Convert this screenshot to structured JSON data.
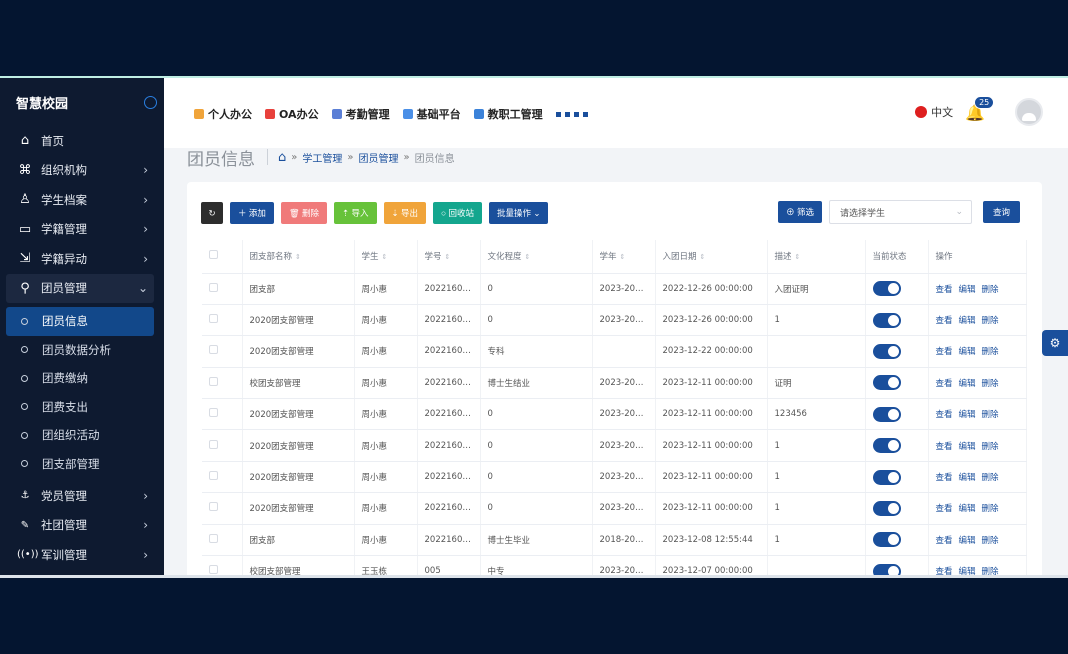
{
  "sidebar": {
    "title": "智慧校园",
    "items": [
      {
        "label": "首页",
        "icon": "⌂",
        "arrow": ""
      },
      {
        "label": "组织机构",
        "icon": "⌘",
        "arrow": "›"
      },
      {
        "label": "学生档案",
        "icon": "♙",
        "arrow": "›"
      },
      {
        "label": "学籍管理",
        "icon": "▭",
        "arrow": "›"
      },
      {
        "label": "学籍异动",
        "icon": "⇲",
        "arrow": "›"
      },
      {
        "label": "团员管理",
        "icon": "⚲",
        "arrow": "⌄"
      }
    ],
    "sub_items": [
      {
        "label": "团员信息"
      },
      {
        "label": "团员数据分析"
      },
      {
        "label": "团费缴纳"
      },
      {
        "label": "团费支出"
      },
      {
        "label": "团组织活动"
      },
      {
        "label": "团支部管理"
      }
    ],
    "bottom_items": [
      {
        "label": "党员管理",
        "icon": "⚓",
        "arrow": "›"
      },
      {
        "label": "社团管理",
        "icon": "✎",
        "arrow": "›"
      },
      {
        "label": "军训管理",
        "icon": "((•))",
        "arrow": "›"
      }
    ]
  },
  "header": {
    "nav": [
      {
        "label": "个人办公",
        "color": "#f0a43a"
      },
      {
        "label": "OA办公",
        "color": "#e8413c"
      },
      {
        "label": "考勤管理",
        "color": "#5b7fd6"
      },
      {
        "label": "基础平台",
        "color": "#4a8fe7"
      },
      {
        "label": "教职工管理",
        "color": "#3b82d9"
      }
    ],
    "language": "中文",
    "notification_count": "25"
  },
  "page": {
    "title": "团员信息",
    "breadcrumb": [
      "学工管理",
      "团员管理",
      "团员信息"
    ]
  },
  "toolbar": {
    "refresh": "↻",
    "add": "＋ 添加",
    "delete": "🗑 删除",
    "import": "⇡ 导入",
    "export": "⇣ 导出",
    "recycle": "○ 回收站",
    "batch": "批量操作 ⌄",
    "filter": "⊕ 筛选",
    "select_placeholder": "请选择学生",
    "query": "查询"
  },
  "table": {
    "headers": [
      "团支部名称",
      "学生",
      "学号",
      "文化程度",
      "学年",
      "入团日期",
      "描述",
      "当前状态",
      "操作"
    ],
    "ops": [
      "查看",
      "编辑",
      "删除"
    ],
    "rows": [
      {
        "branch": "团支部",
        "student": "周小惠",
        "no": "20221601...",
        "edu": "0",
        "year": "2023-202...",
        "date": "2022-12-26 00:00:00",
        "desc": "入团证明"
      },
      {
        "branch": "2020团支部管理",
        "student": "周小惠",
        "no": "20221601...",
        "edu": "0",
        "year": "2023-202...",
        "date": "2023-12-26 00:00:00",
        "desc": "1"
      },
      {
        "branch": "2020团支部管理",
        "student": "周小惠",
        "no": "20221601...",
        "edu": "专科",
        "year": "",
        "date": "2023-12-22 00:00:00",
        "desc": ""
      },
      {
        "branch": "校团支部管理",
        "student": "周小惠",
        "no": "20221601...",
        "edu": "博士生结业",
        "year": "2023-202...",
        "date": "2023-12-11 00:00:00",
        "desc": "证明"
      },
      {
        "branch": "2020团支部管理",
        "student": "周小惠",
        "no": "20221601...",
        "edu": "0",
        "year": "2023-202...",
        "date": "2023-12-11 00:00:00",
        "desc": "123456"
      },
      {
        "branch": "2020团支部管理",
        "student": "周小惠",
        "no": "20221601...",
        "edu": "0",
        "year": "2023-202...",
        "date": "2023-12-11 00:00:00",
        "desc": "1"
      },
      {
        "branch": "2020团支部管理",
        "student": "周小惠",
        "no": "20221601...",
        "edu": "0",
        "year": "2023-202...",
        "date": "2023-12-11 00:00:00",
        "desc": "1"
      },
      {
        "branch": "2020团支部管理",
        "student": "周小惠",
        "no": "20221601...",
        "edu": "0",
        "year": "2023-202...",
        "date": "2023-12-11 00:00:00",
        "desc": "1"
      },
      {
        "branch": "团支部",
        "student": "周小惠",
        "no": "20221601...",
        "edu": "博士生毕业",
        "year": "2018-201...",
        "date": "2023-12-08 12:55:44",
        "desc": "1"
      },
      {
        "branch": "校团支部管理",
        "student": "王玉栋",
        "no": "005",
        "edu": "中专",
        "year": "2023-202...",
        "date": "2023-12-07 00:00:00",
        "desc": ""
      }
    ]
  },
  "colors": {
    "primary": "#1a4f9c",
    "sidebar": "#0e1a30",
    "danger": "#f07a7a",
    "success": "#67c23a",
    "warning": "#f0a43a",
    "teal": "#14a68e"
  }
}
